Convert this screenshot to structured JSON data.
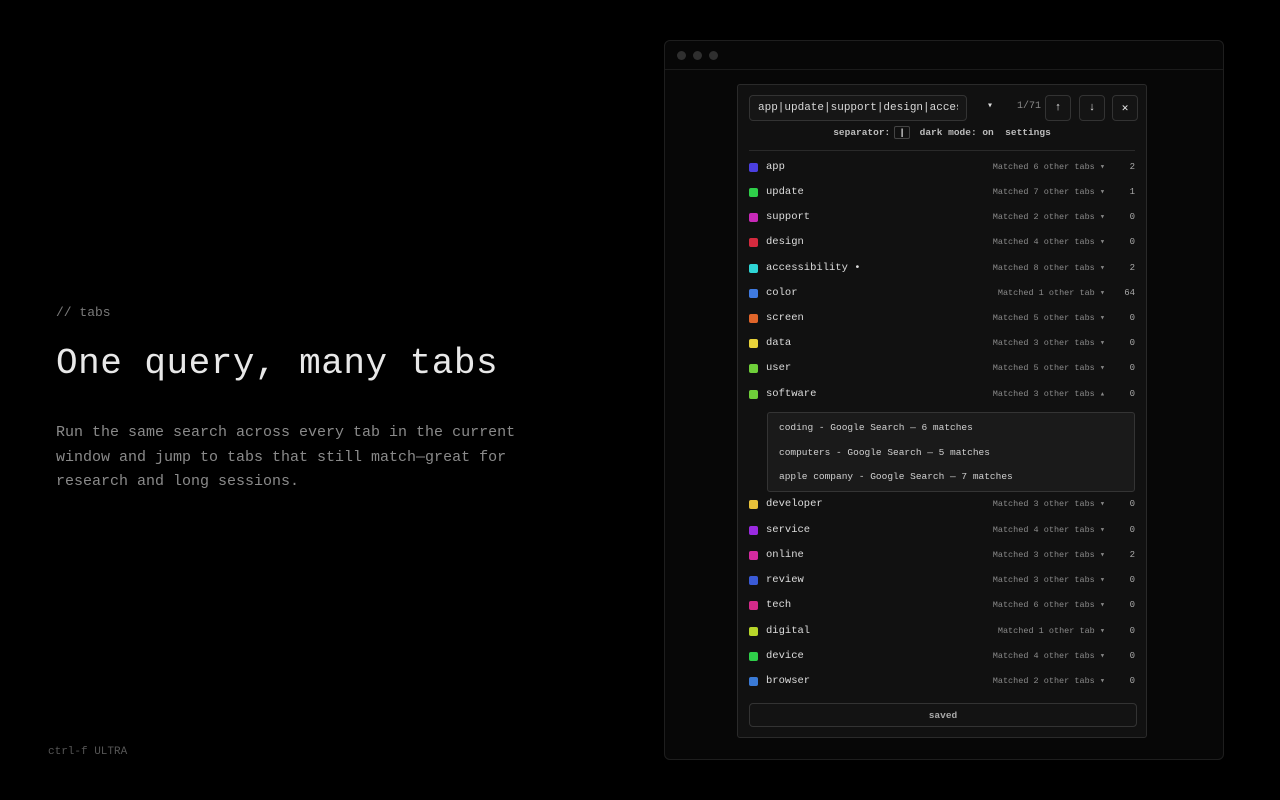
{
  "hero": {
    "kicker": "// tabs",
    "title": "One query, many tabs",
    "description": "Run the same search across every tab in the current window and jump to tabs that still match—great for research and long sessions.",
    "footer": "ctrl-f ULTRA"
  },
  "search": {
    "query": "app|update|support|design|accessibility",
    "dropdown_icon": "▾",
    "counter": "1/71",
    "prev_icon": "↑",
    "next_icon": "↓",
    "close_icon": "✕"
  },
  "options": {
    "separator_label": "separator:",
    "separator_value": "|",
    "dark_mode": "dark mode: on",
    "settings": "settings"
  },
  "terms": [
    {
      "label": "app",
      "matched": "Matched 6 other tabs ▾",
      "count": "2",
      "color": "#4b3fe0"
    },
    {
      "label": "update",
      "matched": "Matched 7 other tabs ▾",
      "count": "1",
      "color": "#2fcf4a"
    },
    {
      "label": "support",
      "matched": "Matched 2 other tabs ▾",
      "count": "0",
      "color": "#c829b8"
    },
    {
      "label": "design",
      "matched": "Matched 4 other tabs ▾",
      "count": "0",
      "color": "#d42a3e"
    },
    {
      "label": "accessibility •",
      "matched": "Matched 8 other tabs ▾",
      "count": "2",
      "color": "#2fd6d6"
    },
    {
      "label": "color",
      "matched": "Matched 1 other tab ▾",
      "count": "64",
      "color": "#3f7ae0"
    },
    {
      "label": "screen",
      "matched": "Matched 5 other tabs ▾",
      "count": "0",
      "color": "#e0652a"
    },
    {
      "label": "data",
      "matched": "Matched 3 other tabs ▾",
      "count": "0",
      "color": "#e8d23a"
    },
    {
      "label": "user",
      "matched": "Matched 5 other tabs ▾",
      "count": "0",
      "color": "#6fcf3a"
    },
    {
      "label": "software",
      "matched": "Matched 3 other tabs ▴",
      "count": "0",
      "color": "#6fcf3a"
    },
    {
      "label": "developer",
      "matched": "Matched 3 other tabs ▾",
      "count": "0",
      "color": "#e8c23a"
    },
    {
      "label": "service",
      "matched": "Matched 4 other tabs ▾",
      "count": "0",
      "color": "#9a2ae0"
    },
    {
      "label": "online",
      "matched": "Matched 3 other tabs ▾",
      "count": "2",
      "color": "#d42aa0"
    },
    {
      "label": "review",
      "matched": "Matched 3 other tabs ▾",
      "count": "0",
      "color": "#3a5ad6"
    },
    {
      "label": "tech",
      "matched": "Matched 6 other tabs ▾",
      "count": "0",
      "color": "#d42a8a"
    },
    {
      "label": "digital",
      "matched": "Matched 1 other tab ▾",
      "count": "0",
      "color": "#b8d62a"
    },
    {
      "label": "device",
      "matched": "Matched 4 other tabs ▾",
      "count": "0",
      "color": "#2fcf4a"
    },
    {
      "label": "browser",
      "matched": "Matched 2 other tabs ▾",
      "count": "0",
      "color": "#3a7ad6"
    }
  ],
  "expanded_matches": [
    "coding - Google Search — 6 matches",
    "computers - Google Search — 5 matches",
    "apple company - Google Search — 7 matches"
  ],
  "saved_label": "saved"
}
